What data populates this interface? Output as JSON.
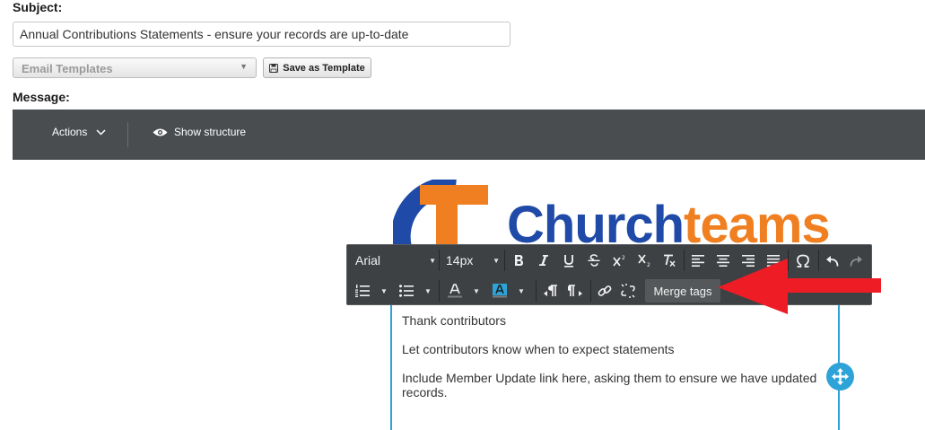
{
  "subject": {
    "label": "Subject:",
    "value": "Annual Contributions Statements - ensure your records are up-to-date"
  },
  "templates": {
    "select_value": "Email Templates",
    "save_label": "Save as Template"
  },
  "message": {
    "label": "Message:"
  },
  "editor_bar": {
    "actions_label": "Actions",
    "show_structure_label": "Show structure"
  },
  "toolbar": {
    "font_family": "Arial",
    "font_size": "14px",
    "merge_tags_label": "Merge tags",
    "icons": [
      "bold-icon",
      "italic-icon",
      "underline-icon",
      "strikethrough-icon",
      "superscript-icon",
      "subscript-icon",
      "clear-format-icon",
      "align-left-icon",
      "align-center-icon",
      "align-right-icon",
      "align-justify-icon",
      "special-char-icon",
      "undo-icon",
      "redo-icon",
      "ordered-list-icon",
      "bullet-list-icon",
      "text-color-icon",
      "background-color-icon",
      "ltr-icon",
      "rtl-icon",
      "link-icon",
      "unlink-icon"
    ]
  },
  "logo": {
    "text_part1": "Church",
    "text_part2": "teams",
    "color_blue": "#1f4aa8",
    "color_orange": "#f07f22"
  },
  "content": {
    "p1": "Thank contributors",
    "p2": "Let contributors know when to expect statements",
    "p3": "Include Member Update link here, asking them to ensure we have updated records."
  },
  "colors": {
    "editor_bar": "#4a4d50",
    "toolbar_bg": "#3e4144",
    "selection_blue": "#2ea3d8",
    "annotation_red": "#ee1c25"
  }
}
